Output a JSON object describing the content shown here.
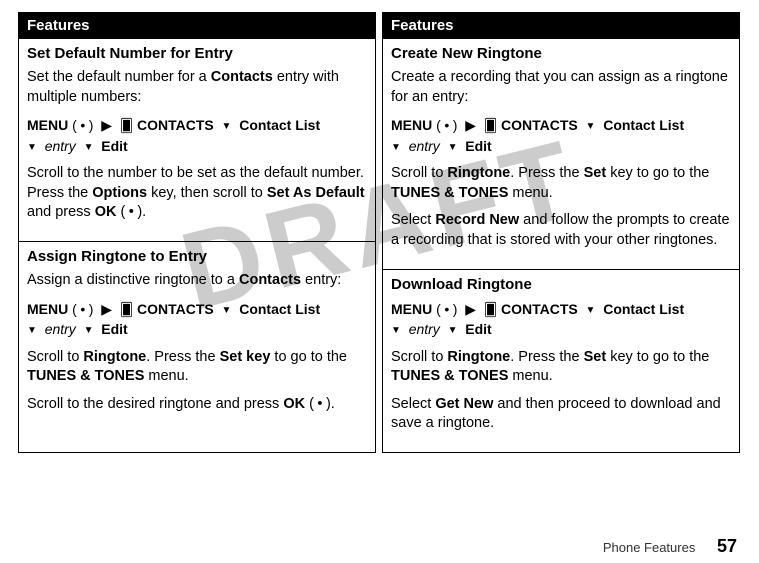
{
  "watermark": "DRAFT",
  "columns": {
    "left": {
      "header": "Features",
      "sections": [
        {
          "title": "Set Default Number for Entry",
          "intro_pre": "Set the default number for a ",
          "intro_bold": "Contacts",
          "intro_post": " entry with multiple numbers:",
          "menu_label": "MENU",
          "contacts_label": "CONTACTS",
          "contact_list_label": "Contact List",
          "entry_label": "entry",
          "edit_label": "Edit",
          "p1_a": "Scroll to the number to be set as the default number. Press the ",
          "p1_b": "Options",
          "p1_c": " key, then scroll to ",
          "p1_d": "Set As Default",
          "p1_e": " and press ",
          "p1_f": "OK",
          "p1_g": " (",
          "p1_h": ")."
        },
        {
          "title": "Assign Ringtone to Entry",
          "intro_pre": "Assign a distinctive ringtone to a ",
          "intro_bold": "Contacts",
          "intro_post": " entry:",
          "menu_label": "MENU",
          "contacts_label": "CONTACTS",
          "contact_list_label": "Contact List",
          "entry_label": "entry",
          "edit_label": "Edit",
          "p1_a": "Scroll to ",
          "p1_b": "Ringtone",
          "p1_c": ". Press the ",
          "p1_d": "Set key",
          "p1_e": " to go to the ",
          "p1_f": "TUNES & TONES",
          "p1_g": " menu.",
          "p2_a": "Scroll to the desired ringtone and press ",
          "p2_b": "OK",
          "p2_c": " (",
          "p2_d": ")."
        }
      ]
    },
    "right": {
      "header": "Features",
      "sections": [
        {
          "title": "Create New Ringtone",
          "intro": "Create a recording that you can assign as a ringtone for an entry:",
          "menu_label": "MENU",
          "contacts_label": "CONTACTS",
          "contact_list_label": "Contact List",
          "entry_label": "entry",
          "edit_label": "Edit",
          "p1_a": "Scroll to ",
          "p1_b": "Ringtone",
          "p1_c": ". Press the ",
          "p1_d": "Set",
          "p1_e": " key to go to the ",
          "p1_f": "TUNES & TONES",
          "p1_g": " menu.",
          "p2_a": "Select ",
          "p2_b": "Record New",
          "p2_c": " and follow the prompts to create a recording that is stored with your other ringtones."
        },
        {
          "title": "Download Ringtone",
          "menu_label": "MENU",
          "contacts_label": "CONTACTS",
          "contact_list_label": "Contact List",
          "entry_label": "entry",
          "edit_label": "Edit",
          "p1_a": "Scroll to ",
          "p1_b": "Ringtone",
          "p1_c": ". Press the ",
          "p1_d": "Set",
          "p1_e": " key to go to the ",
          "p1_f": "TUNES & TONES",
          "p1_g": " menu.",
          "p2_a": "Select ",
          "p2_b": "Get New",
          "p2_c": " and then proceed to download and save a ringtone."
        }
      ]
    }
  },
  "footer": {
    "label": "Phone Features",
    "page": "57"
  },
  "symbols": {
    "dot": "•",
    "triangle_right": "▶",
    "triangle_down": "▼",
    "cards_icon": "🂠"
  }
}
